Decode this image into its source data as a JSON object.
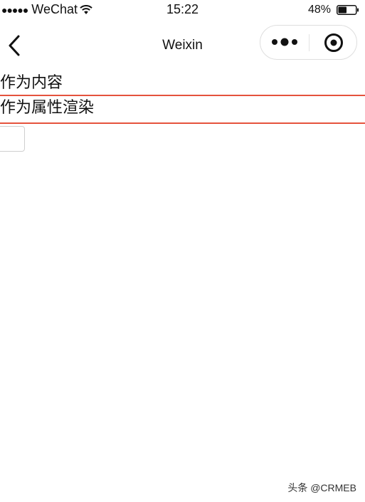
{
  "status_bar": {
    "signal": "●●●●●",
    "carrier": "WeChat",
    "time": "15:22",
    "battery_percent": "48%",
    "battery_level": 0.48,
    "icons": [
      "wifi-icon",
      "battery-icon"
    ]
  },
  "nav_bar": {
    "title": "Weixin",
    "back_icon": "chevron-left-icon",
    "more_icon": "more-dots-icon",
    "close_icon": "target-circle-icon"
  },
  "content": {
    "row_content_label": "作为内容",
    "row_attribute_label": "作为属性渲染",
    "input_value": "",
    "accent_color": "#e5533d"
  },
  "watermark": "头条 @CRMEB"
}
